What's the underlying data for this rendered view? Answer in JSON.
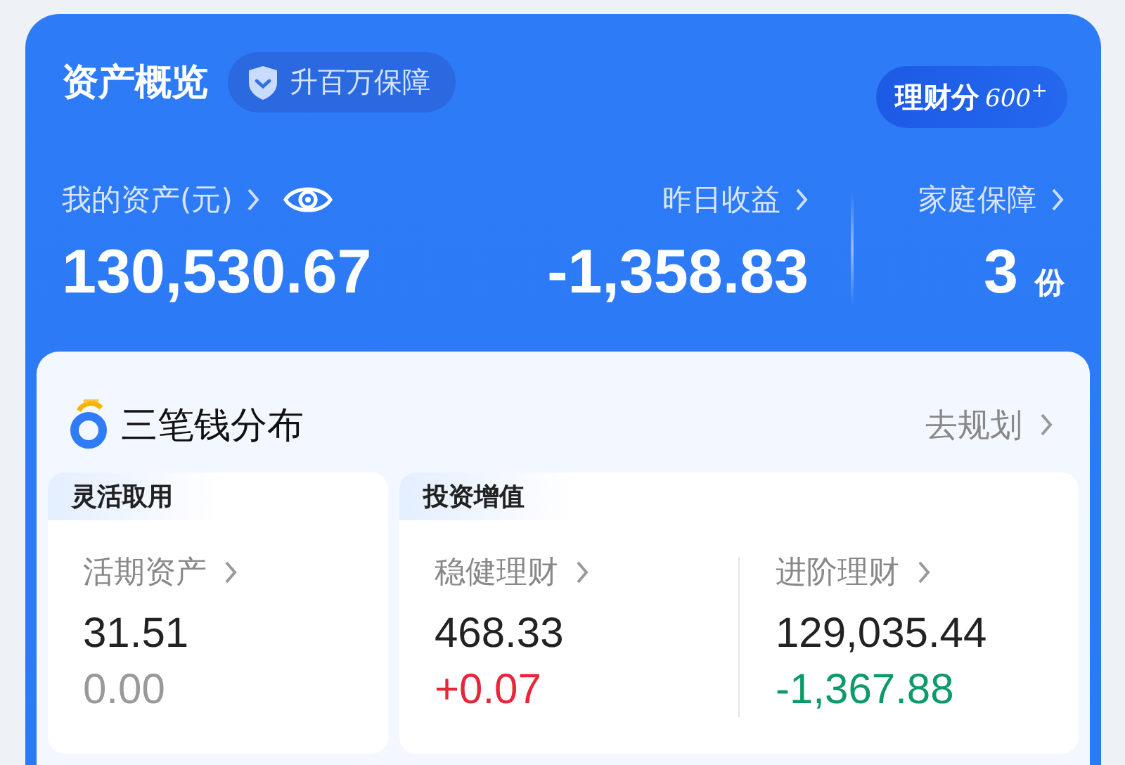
{
  "header": {
    "title": "资产概览",
    "chip": "升百万保障",
    "score": {
      "label": "理财分",
      "value": "600$^{+}$"
    }
  },
  "stats": [
    {
      "kind": "total",
      "label": "我的资产(元)",
      "value": "130,530.67"
    },
    {
      "kind": "daily",
      "label": "昨日收益",
      "value": "-1,358.83"
    },
    {
      "kind": "cover",
      "label": "家庭保障",
      "value": "3",
      "unit": "份"
    }
  ],
  "distribution": {
    "title": "三笔钱分布",
    "link": "去规划",
    "groups": [
      {
        "tag": "灵活取用",
        "items": [
          {
            "label": "活期资产",
            "amount": "31.51",
            "change": "0.00",
            "color": "#999999"
          }
        ]
      },
      {
        "tag": "投资增值",
        "items": [
          {
            "label": "稳健理财",
            "amount": "468.33",
            "change": "+0.07",
            "color": "#e8263a"
          },
          {
            "label": "进阶理财",
            "amount": "129,035.44",
            "change": "-1,367.88",
            "color": "#0b9a68"
          }
        ]
      }
    ]
  }
}
